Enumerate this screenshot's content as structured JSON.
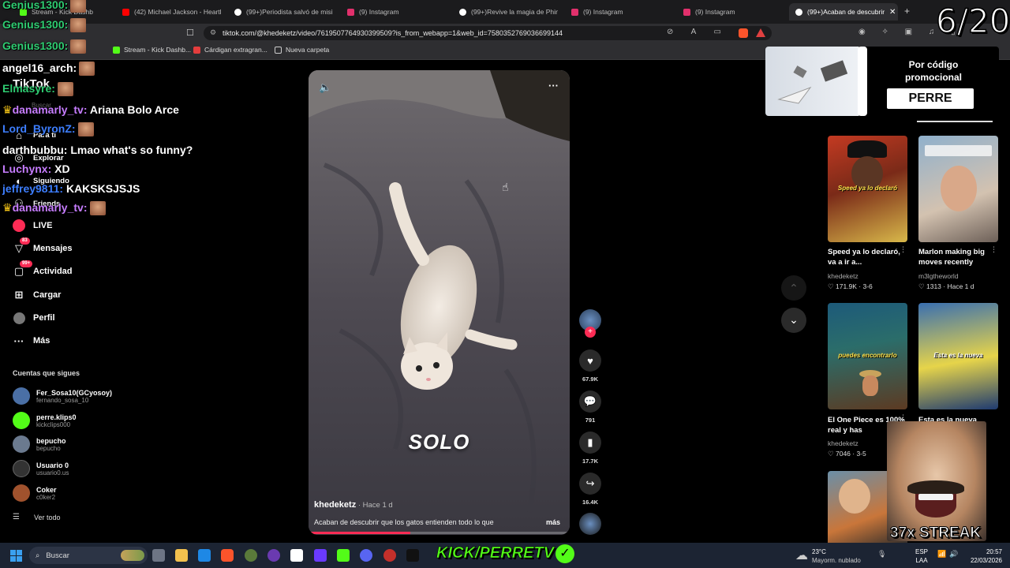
{
  "browser": {
    "tabs": [
      {
        "label": "Stream - Kick Dashb",
        "color": "#53fc18"
      },
      {
        "label": "(42) Michael Jackson - Heartbr",
        "color": "#ff0000"
      },
      {
        "label": "(99+)Periodista salvó de misil p",
        "color": "#ffffff"
      },
      {
        "label": "(9) Instagram",
        "color": "#e1306c"
      },
      {
        "label": "(99+)Revive la magia de Phine",
        "color": "#ffffff"
      },
      {
        "label": "(9) Instagram",
        "color": "#e1306c"
      },
      {
        "label": "(9) Instagram",
        "color": "#e1306c"
      },
      {
        "label": "(99+)Acaban de descubrir",
        "color": "#ffffff"
      }
    ],
    "url": "tiktok.com/@khedeketz/video/7619507764930399509?is_from_webapp=1&web_id=7580352769036699144",
    "bookmarks": [
      "Stream - Kick Dashb...",
      "Cárdigan extragran...",
      "Nueva carpeta"
    ]
  },
  "counter": "6/20",
  "chat": [
    {
      "user": "Genius1300:",
      "msg": "",
      "color": "#2ecc71",
      "emote": true
    },
    {
      "user": "Genius1300:",
      "msg": "",
      "color": "#2ecc71",
      "emote": true
    },
    {
      "user": "Genius1300:",
      "msg": "",
      "color": "#2ecc71",
      "emote": true
    },
    {
      "user": "angel16_arch:",
      "msg": "",
      "color": "#ffffff",
      "emote": true
    },
    {
      "user": "Elmasyre:",
      "msg": "",
      "color": "#2ecc71",
      "emote": true
    },
    {
      "user": "danamarly_tv:",
      "msg": "Ariana Bolo Arce",
      "color": "#c77dff",
      "emote": false
    },
    {
      "user": "Lord_ByronZ:",
      "msg": "",
      "color": "#3d7eff",
      "emote": true
    },
    {
      "user": "darthbubbu:",
      "msg": "Lmao what's so funny?",
      "color": "#ffffff",
      "emote": false
    },
    {
      "user": "Luchynx:",
      "msg": "XD",
      "color": "#c77dff",
      "emote": false
    },
    {
      "user": "jeffrey9811:",
      "msg": "KAKSKSJSJS",
      "color": "#3d7eff",
      "emote": false
    },
    {
      "user": "danamarly_tv:",
      "msg": "",
      "color": "#c77dff",
      "emote": true
    }
  ],
  "sidebar": {
    "logo": "TikTok",
    "search_placeholder": "Buscar",
    "items": [
      {
        "label": "Para ti",
        "icon": "home-icon"
      },
      {
        "label": "Explorar",
        "icon": "compass-icon"
      },
      {
        "label": "Siguiendo",
        "icon": "following-icon"
      },
      {
        "label": "Friends",
        "icon": "friends-icon"
      },
      {
        "label": "LIVE",
        "icon": "live-icon"
      },
      {
        "label": "Mensajes",
        "icon": "message-icon",
        "badge": "83"
      },
      {
        "label": "Actividad",
        "icon": "activity-icon",
        "badge": "99+"
      },
      {
        "label": "Cargar",
        "icon": "upload-icon"
      },
      {
        "label": "Perfil",
        "icon": "profile-icon"
      },
      {
        "label": "Más",
        "icon": "more-icon"
      }
    ],
    "following_title": "Cuentas que sigues",
    "following": [
      {
        "name": "Fer_Sosa10(GCyosoy)",
        "handle": "fernando_sosa_10",
        "color": "#4a6fa5"
      },
      {
        "name": "perre.klips0",
        "handle": "kickclips000",
        "color": "#53fc18"
      },
      {
        "name": "bepucho",
        "handle": "bepucho",
        "color": "#6b7a8f"
      },
      {
        "name": "Usuario 0",
        "handle": "usuario0.us",
        "color": "#333333"
      },
      {
        "name": "Coker",
        "handle": "c0ker2",
        "color": "#a0522d"
      }
    ],
    "see_all": "Ver todo"
  },
  "video": {
    "caption_overlay": "SOLO",
    "author": "khedeketz",
    "time": "Hace 1 d",
    "description": "Acaban de descubrir que los gatos entienden todo lo que",
    "more": "más",
    "progress": 0.39
  },
  "actions": {
    "likes": "67.9K",
    "comments": "791",
    "saves": "17.7K",
    "shares": "16.4K"
  },
  "promo": {
    "line1": "Por código",
    "line2": "promocional",
    "code": "PERRE"
  },
  "recommended": [
    {
      "title": "Speed ya lo declaró, va a ir a...",
      "author": "khedeketz",
      "stats": "171.9K · 3-6",
      "thumb_text": "Speed ya lo declaró",
      "c1": "#a8351e",
      "c2": "#e8c64a"
    },
    {
      "title": "Marlon making big moves recently",
      "author": "m3lgtheworld",
      "stats": "1313 · Hace 1 d",
      "thumb_text": "",
      "c1": "#c9b8a8",
      "c2": "#6f8fa8"
    },
    {
      "title": "El One Piece es 100% real y has",
      "author": "khedeketz",
      "stats": "7046 · 3-5",
      "thumb_text": "puedes encontrarlo",
      "c1": "#1f4d6b",
      "c2": "#6b4a2a"
    },
    {
      "title": "Esta es la nueva",
      "author": "",
      "stats": "",
      "thumb_text": "Esta es la nueva",
      "c1": "#2a4f8f",
      "c2": "#d8c33a"
    }
  ],
  "overlay": {
    "kick": "KICK/PERRETV",
    "streak": "37x STREAK"
  },
  "taskbar": {
    "search": "Buscar",
    "weather_temp": "23°C",
    "weather_desc": "Mayorm. nublado",
    "lang1": "ESP",
    "lang2": "LAA",
    "time": "20:57",
    "date": "22/03/2026"
  }
}
